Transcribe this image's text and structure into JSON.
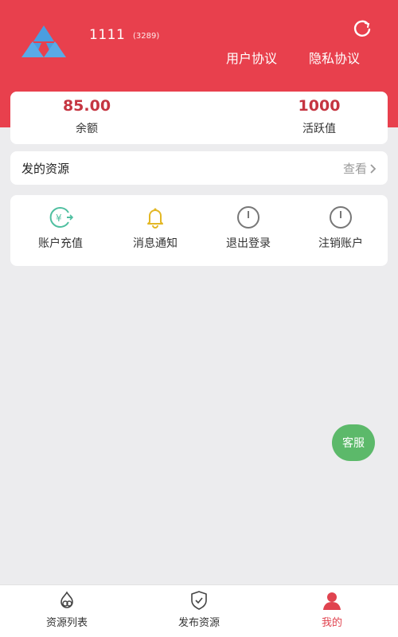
{
  "header": {
    "username": "1111",
    "user_id": "(3289)",
    "user_agreement": "用户协议",
    "privacy_policy": "隐私协议"
  },
  "stats": {
    "balance_value": "85.00",
    "balance_label": "余额",
    "active_value": "1000",
    "active_label": "活跃值"
  },
  "resources": {
    "title": "发的资源",
    "view_more": "查看"
  },
  "actions": [
    {
      "label": "账户充值",
      "icon": "recharge-icon"
    },
    {
      "label": "消息通知",
      "icon": "bell-icon"
    },
    {
      "label": "退出登录",
      "icon": "power-icon"
    },
    {
      "label": "注销账户",
      "icon": "power-icon"
    }
  ],
  "service_button": "客服",
  "tabbar": [
    {
      "label": "资源列表",
      "icon": "resource-list-icon"
    },
    {
      "label": "发布资源",
      "icon": "shield-icon"
    },
    {
      "label": "我的",
      "icon": "user-icon",
      "active": true
    }
  ],
  "colors": {
    "primary_red": "#e8404d",
    "value_red": "#c53541",
    "service_green": "#5cb96a",
    "background": "#ececee",
    "logo_blue": "#4a9ee0"
  }
}
